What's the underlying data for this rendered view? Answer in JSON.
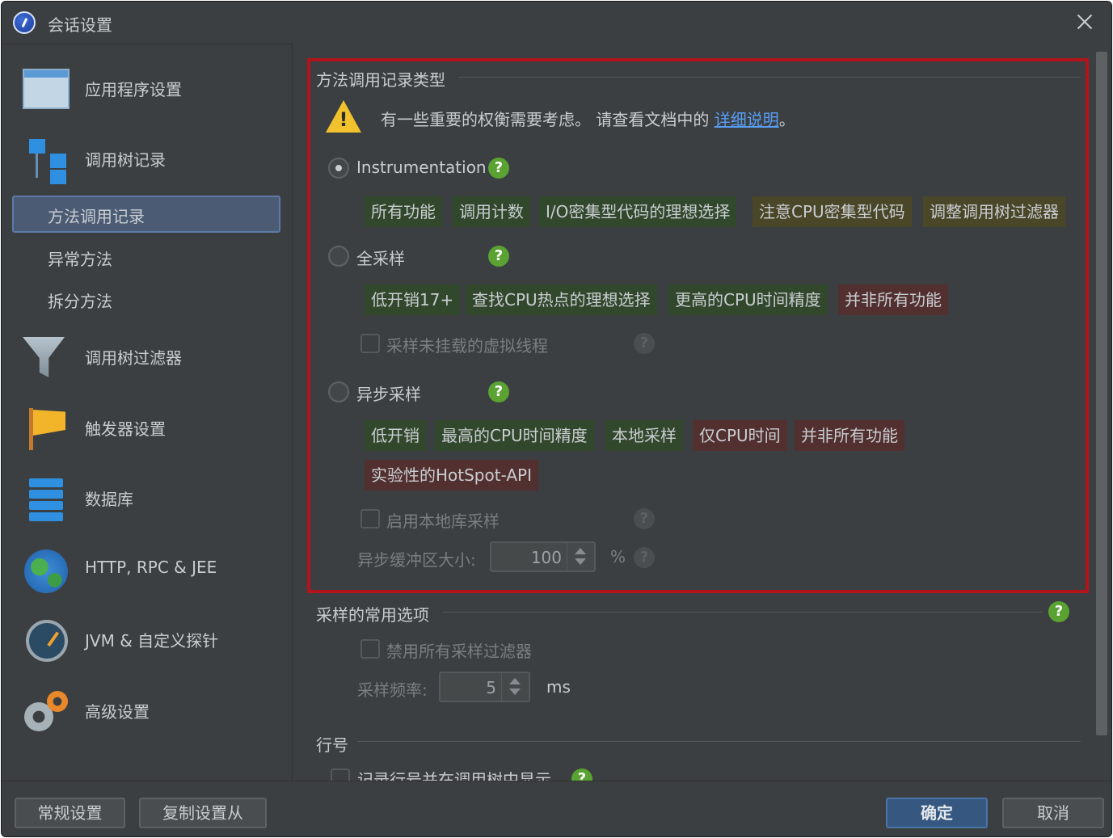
{
  "window": {
    "title": "会话设置"
  },
  "sidebar": {
    "items": [
      {
        "label": "应用程序设置",
        "icon": "app-settings-window-icon"
      },
      {
        "label": "调用树记录",
        "icon": "call-tree-icon"
      },
      {
        "label": "调用树过滤器",
        "icon": "funnel-filter-icon"
      },
      {
        "label": "触发器设置",
        "icon": "flag-icon"
      },
      {
        "label": "数据库",
        "icon": "database-icon"
      },
      {
        "label": "HTTP, RPC & JEE",
        "icon": "globe-icon"
      },
      {
        "label": "JVM & 自定义探针",
        "icon": "gauge-icon"
      },
      {
        "label": "高级设置",
        "icon": "gears-icon"
      }
    ],
    "subitems": [
      {
        "label": "方法调用记录",
        "selected": true
      },
      {
        "label": "异常方法",
        "selected": false
      },
      {
        "label": "拆分方法",
        "selected": false
      }
    ]
  },
  "main": {
    "method_recording": {
      "title": "方法调用记录类型",
      "warning": {
        "text": "有一些重要的权衡需要考虑。 请查看文档中的 ",
        "link": "详细说明",
        "suffix": "。"
      },
      "instrumentation": {
        "label": "Instrumentation",
        "checked": true,
        "tags": [
          {
            "text": "所有功能",
            "color": "green"
          },
          {
            "text": "调用计数",
            "color": "green"
          },
          {
            "text": "I/O密集型代码的理想选择",
            "color": "green"
          },
          {
            "text": "注意CPU密集型代码",
            "color": "yellow"
          },
          {
            "text": "调整调用树过滤器",
            "color": "yellow"
          }
        ]
      },
      "full_sampling": {
        "label": "全采样",
        "checked": false,
        "tags": [
          {
            "text": "低开销17+",
            "color": "green"
          },
          {
            "text": "查找CPU热点的理想选择",
            "color": "green"
          },
          {
            "text": "更高的CPU时间精度",
            "color": "green"
          },
          {
            "text": "并非所有功能",
            "color": "red"
          }
        ],
        "checkbox_label": "采样未挂载的虚拟线程"
      },
      "async_sampling": {
        "label": "异步采样",
        "checked": false,
        "tags": [
          {
            "text": "低开销",
            "color": "green"
          },
          {
            "text": "最高的CPU时间精度",
            "color": "green"
          },
          {
            "text": "本地采样",
            "color": "green"
          },
          {
            "text": "仅CPU时间",
            "color": "red"
          },
          {
            "text": "并非所有功能",
            "color": "red"
          },
          {
            "text": "实验性的HotSpot-API",
            "color": "red"
          }
        ],
        "checkbox_label": "启用本地库采样",
        "buffer_label": "异步缓冲区大小:",
        "buffer_value": "100",
        "buffer_unit": "%"
      }
    },
    "sampling_options": {
      "title": "采样的常用选项",
      "checkbox_label": "禁用所有采样过滤器",
      "freq_label": "采样频率:",
      "freq_value": "5",
      "freq_unit": "ms"
    },
    "line_numbers": {
      "title": "行号",
      "checkbox_label": "记录行号并在调用树中显示"
    }
  },
  "footer": {
    "general_settings": "常规设置",
    "copy_settings_from": "复制设置从",
    "ok": "确定",
    "cancel": "取消"
  },
  "help_mark": "?",
  "colors": {
    "accent": "#365880",
    "highlight_border": "#b3141c",
    "tag_green": "#32482c",
    "tag_yellow": "#4a4628",
    "tag_red": "#52302f"
  }
}
